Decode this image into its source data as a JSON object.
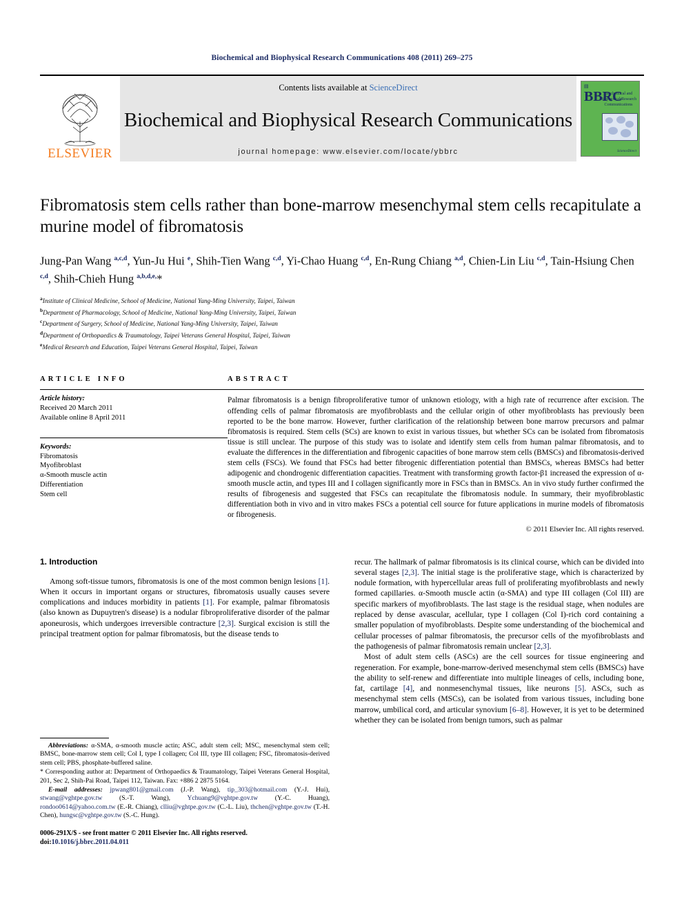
{
  "running_head": "Biochemical and Biophysical Research Communications 408 (2011) 269–275",
  "masthead": {
    "publisher": "ELSEVIER",
    "contents_prefix": "Contents lists available at ",
    "contents_link": "ScienceDirect",
    "journal_title": "Biochemical and Biophysical Research Communications",
    "homepage": "journal homepage: www.elsevier.com/locate/ybbrc",
    "cover": {
      "acronym": "BBRC",
      "title_lines": "Biochemical and Biophysical Research Communications",
      "publisher_mark": "ScienceDirect",
      "bg_color": "#5eb451",
      "text_color": "#1b2a63"
    }
  },
  "article": {
    "title": "Fibromatosis stem cells rather than bone-marrow mesenchymal stem cells recapitulate a murine model of fibromatosis",
    "authors_html": "Jung-Pan Wang <sup>a,c,d</sup>, Yun-Ju Hui <sup>e</sup>, Shih-Tien Wang <sup>c,d</sup>, Yi-Chao Huang <sup>c,d</sup>, En-Rung Chiang <sup>a,d</sup>, Chien-Lin Liu <sup>c,d</sup>, Tain-Hsiung Chen <sup>c,d</sup>, Shih-Chieh Hung <sup>a,b,d,e,</sup>*",
    "affiliations": [
      {
        "mark": "a",
        "text": "Institute of Clinical Medicine, School of Medicine, National Yang-Ming University, Taipei, Taiwan"
      },
      {
        "mark": "b",
        "text": "Department of Pharmacology, School of Medicine, National Yang-Ming University, Taipei, Taiwan"
      },
      {
        "mark": "c",
        "text": "Department of Surgery, School of Medicine, National Yang-Ming University, Taipei, Taiwan"
      },
      {
        "mark": "d",
        "text": "Department of Orthopaedics & Traumatology, Taipei Veterans General Hospital, Taipei, Taiwan"
      },
      {
        "mark": "e",
        "text": "Medical Research and Education, Taipei Veterans General Hospital, Taipei, Taiwan"
      }
    ]
  },
  "article_info": {
    "heading": "ARTICLE INFO",
    "history_label": "Article history:",
    "history_lines": [
      "Received 20 March 2011",
      "Available online 8 April 2011"
    ],
    "keywords_label": "Keywords:",
    "keywords": [
      "Fibromatosis",
      "Myofibroblast",
      "α-Smooth muscle actin",
      "Differentiation",
      "Stem cell"
    ]
  },
  "abstract": {
    "heading": "ABSTRACT",
    "text": "Palmar fibromatosis is a benign fibroproliferative tumor of unknown etiology, with a high rate of recurrence after excision. The offending cells of palmar fibromatosis are myofibroblasts and the cellular origin of other myofibroblasts has previously been reported to be the bone marrow. However, further clarification of the relationship between bone marrow precursors and palmar fibromatosis is required. Stem cells (SCs) are known to exist in various tissues, but whether SCs can be isolated from fibromatosis tissue is still unclear. The purpose of this study was to isolate and identify stem cells from human palmar fibromatosis, and to evaluate the differences in the differentiation and fibrogenic capacities of bone marrow stem cells (BMSCs) and fibromatosis-derived stem cells (FSCs). We found that FSCs had better fibrogenic differentiation potential than BMSCs, whereas BMSCs had better adipogenic and chondrogenic differentiation capacities. Treatment with transforming growth factor-β1 increased the expression of α-smooth muscle actin, and types III and I collagen significantly more in FSCs than in BMSCs. An in vivo study further confirmed the results of fibrogenesis and suggested that FSCs can recapitulate the fibromatosis nodule. In summary, their myofibroblastic differentiation both in vivo and in vitro makes FSCs a potential cell source for future applications in murine models of fibromatosis or fibrogenesis.",
    "copyright": "© 2011 Elsevier Inc. All rights reserved."
  },
  "introduction": {
    "heading": "1. Introduction",
    "left_paragraph_html": "Among soft-tissue tumors, fibromatosis is one of the most common benign lesions <span class=\"ref\">[1]</span>. When it occurs in important organs or structures, fibromatosis usually causes severe complications and induces morbidity in patients <span class=\"ref\">[1]</span>. For example, palmar fibromatosis (also known as Dupuytren's disease) is a nodular fibroproliferative disorder of the palmar aponeurosis, which undergoes irreversible contracture <span class=\"ref\">[2,3]</span>. Surgical excision is still the principal treatment option for palmar fibromatosis, but the disease tends to",
    "right_paragraph_1_html": "recur. The hallmark of palmar fibromatosis is its clinical course, which can be divided into several stages <span class=\"ref\">[2,3]</span>. The initial stage is the proliferative stage, which is characterized by nodule formation, with hypercellular areas full of proliferating myofibroblasts and newly formed capillaries. α-Smooth muscle actin (α-SMA) and type III collagen (Col III) are specific markers of myofibroblasts. The last stage is the residual stage, when nodules are replaced by dense avascular, acellular, type I collagen (Col I)-rich cord containing a smaller population of myofibroblasts. Despite some understanding of the biochemical and cellular processes of palmar fibromatosis, the precursor cells of the myofibroblasts and the pathogenesis of palmar fibromatosis remain unclear <span class=\"ref\">[2,3]</span>.",
    "right_paragraph_2_html": "Most of adult stem cells (ASCs) are the cell sources for tissue engineering and regeneration. For example, bone-marrow-derived mesenchymal stem cells (BMSCs) have the ability to self-renew and differentiate into multiple lineages of cells, including bone, fat, cartilage <span class=\"ref\">[4]</span>, and nonmesenchymal tissues, like neurons <span class=\"ref\">[5]</span>. ASCs, such as mesenchymal stem cells (MSCs), can be isolated from various tissues, including bone marrow, umbilical cord, and articular synovium <span class=\"ref\">[6–8]</span>. However, it is yet to be determined whether they can be isolated from benign tumors, such as palmar"
  },
  "footnotes": {
    "abbreviations_html": "<span class=\"it\">Abbreviations:</span> α-SMA, α-smooth muscle actin; ASC, adult stem cell; MSC, mesenchymal stem cell; BMSC, bone-marrow stem cell; Col I, type I collagen; Col III, type III collagen; FSC, fibromatosis-derived stem cell; PBS, phosphate-buffered saline.",
    "corresponding_html": "* Corresponding author at: Department of Orthopaedics & Traumatology, Taipei Veterans General Hospital, 201, Sec 2, Shih-Pai Road, Taipei 112, Taiwan. Fax: +886 2 2875 5164.",
    "emails_html": "<span class=\"it\">E-mail addresses:</span> <span class=\"lnk\">jpwang801@gmail.com</span> (J.-P. Wang), <span class=\"lnk\">tip_303@hotmail.com</span> (Y.-J. Hui), <span class=\"lnk\">stwang@vghtpe.gov.tw</span> (S.-T. Wang), <span class=\"lnk\">Ychuang9@vghtpe.gov.tw</span> (Y.-C. Huang), <span class=\"lnk\">rondoo0614@yahoo.com.tw</span> (E.-R. Chiang), <span class=\"lnk\">clliu@vghtpe.gov.tw</span> (C.-L. Liu), <span class=\"lnk\">thchen@vghtpe.gov.tw</span> (T.-H. Chen), <span class=\"lnk\">hungsc@vghtpe.gov.tw</span> (S.-C. Hung).",
    "issn_line": "0006-291X/$ - see front matter © 2011 Elsevier Inc. All rights reserved.",
    "doi_label": "doi:",
    "doi_value": "10.1016/j.bbrc.2011.04.011"
  }
}
